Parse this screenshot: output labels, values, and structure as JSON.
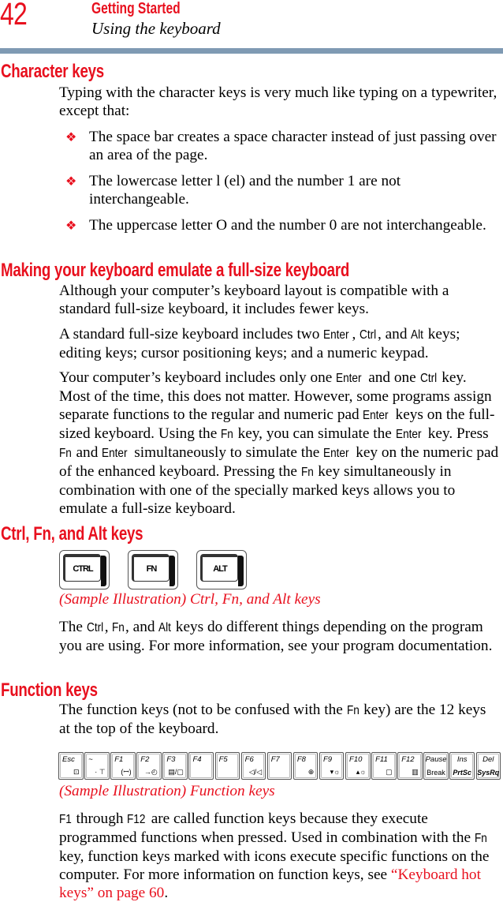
{
  "header": {
    "page_number": "42",
    "chapter": "Getting Started",
    "section": "Using the keyboard"
  },
  "character_keys": {
    "heading": "Character keys",
    "intro": "Typing with the character keys is very much like typing on a typewriter, except that:",
    "bullets": [
      "The space bar creates a space character instead of just passing over an area of the page.",
      "The lowercase letter l (el) and the number 1 are not interchangeable.",
      "The uppercase letter O and the number 0 are not interchangeable."
    ],
    "bullet_glyph": "❖"
  },
  "emulate": {
    "heading": "Making your keyboard emulate a full-size keyboard",
    "paragraphs": [
      [
        {
          "t": "Although your computer’s keyboard layout is compatible with a standard full-size keyboard, it includes fewer keys."
        }
      ],
      [
        {
          "t": "A standard full-size keyboard includes two "
        },
        {
          "k": "Enter"
        },
        {
          "t": ", "
        },
        {
          "k": "Ctrl"
        },
        {
          "t": ", and "
        },
        {
          "k": "Alt"
        },
        {
          "t": " keys; editing keys; cursor positioning keys; and a numeric keypad."
        }
      ],
      [
        {
          "t": "Your computer’s keyboard includes only one "
        },
        {
          "k": "Enter"
        },
        {
          "t": " and one "
        },
        {
          "k": "Ctrl"
        },
        {
          "t": " key. Most of the time, this does not matter. However, some programs assign separate functions to the regular and numeric pad "
        },
        {
          "k": "Enter"
        },
        {
          "t": " keys on the full-sized keyboard. Using the "
        },
        {
          "k": "Fn"
        },
        {
          "t": " key, you can simulate the "
        },
        {
          "k": "Enter"
        },
        {
          "t": " key. Press "
        },
        {
          "k": "Fn"
        },
        {
          "t": " and "
        },
        {
          "k": "Enter"
        },
        {
          "t": " simultaneously to simulate the "
        },
        {
          "k": "Enter"
        },
        {
          "t": " key on the numeric pad of the enhanced keyboard. Pressing the "
        },
        {
          "k": "Fn"
        },
        {
          "t": " key simultaneously in combination with one of the specially marked keys allows you to emulate a full-size keyboard."
        }
      ]
    ]
  },
  "modifier_keys": {
    "heading": "Ctrl, Fn, and Alt keys",
    "keycaps": [
      "CTRL",
      "FN",
      "ALT"
    ],
    "caption": "(Sample Illustration) Ctrl, Fn, and Alt keys",
    "paragraph": [
      {
        "t": "The "
      },
      {
        "k": "Ctrl"
      },
      {
        "t": ", "
      },
      {
        "k": "Fn"
      },
      {
        "t": ", and "
      },
      {
        "k": "Alt"
      },
      {
        "t": " keys do different things depending on the program you are using. For more information, see your program documentation."
      }
    ]
  },
  "function_keys": {
    "heading": "Function keys",
    "paragraph": [
      {
        "t": "The function keys (not to be confused with the "
      },
      {
        "k": "Fn"
      },
      {
        "t": " key) are the 12 keys at the top of the keyboard."
      }
    ],
    "keys": [
      {
        "top": "Esc",
        "bottom": "⊡"
      },
      {
        "top": "~",
        "bottom": "·  ⊤"
      },
      {
        "top": "F1",
        "bottom": "(ꟷ)"
      },
      {
        "top": "F2",
        "bottom": "→◴"
      },
      {
        "top": "F3",
        "bottom": "▤/▢"
      },
      {
        "top": "F4",
        "bottom": ""
      },
      {
        "top": "F5",
        "bottom": ""
      },
      {
        "top": "F6",
        "bottom": "◁/◁"
      },
      {
        "top": "F7",
        "bottom": ""
      },
      {
        "top": "F8",
        "bottom": "⊕"
      },
      {
        "top": "F9",
        "bottom": "▾☼"
      },
      {
        "top": "F10",
        "bottom": "▴☼"
      },
      {
        "top": "F11",
        "bottom": "▢"
      },
      {
        "top": "F12",
        "bottom": "▥"
      },
      {
        "top": "Pause",
        "bottom": "Break"
      },
      {
        "top": "Ins",
        "bottom": "PrtSc"
      },
      {
        "top": "Del",
        "bottom": "SysRq"
      }
    ],
    "caption": "(Sample Illustration) Function keys",
    "paragraph2": [
      {
        "k": "F1"
      },
      {
        "t": " through "
      },
      {
        "k": "F12"
      },
      {
        "t": " are called function keys because they execute programmed functions when pressed. Used in combination with the "
      },
      {
        "k": "Fn"
      },
      {
        "t": " key, function keys marked with icons execute specific functions on the computer. For more information on function keys, see "
      },
      {
        "l": "“Keyboard hot keys” on page 60"
      },
      {
        "t": "."
      }
    ]
  },
  "colors": {
    "accent": "#e8101e",
    "rule": "#7f9ab3"
  }
}
